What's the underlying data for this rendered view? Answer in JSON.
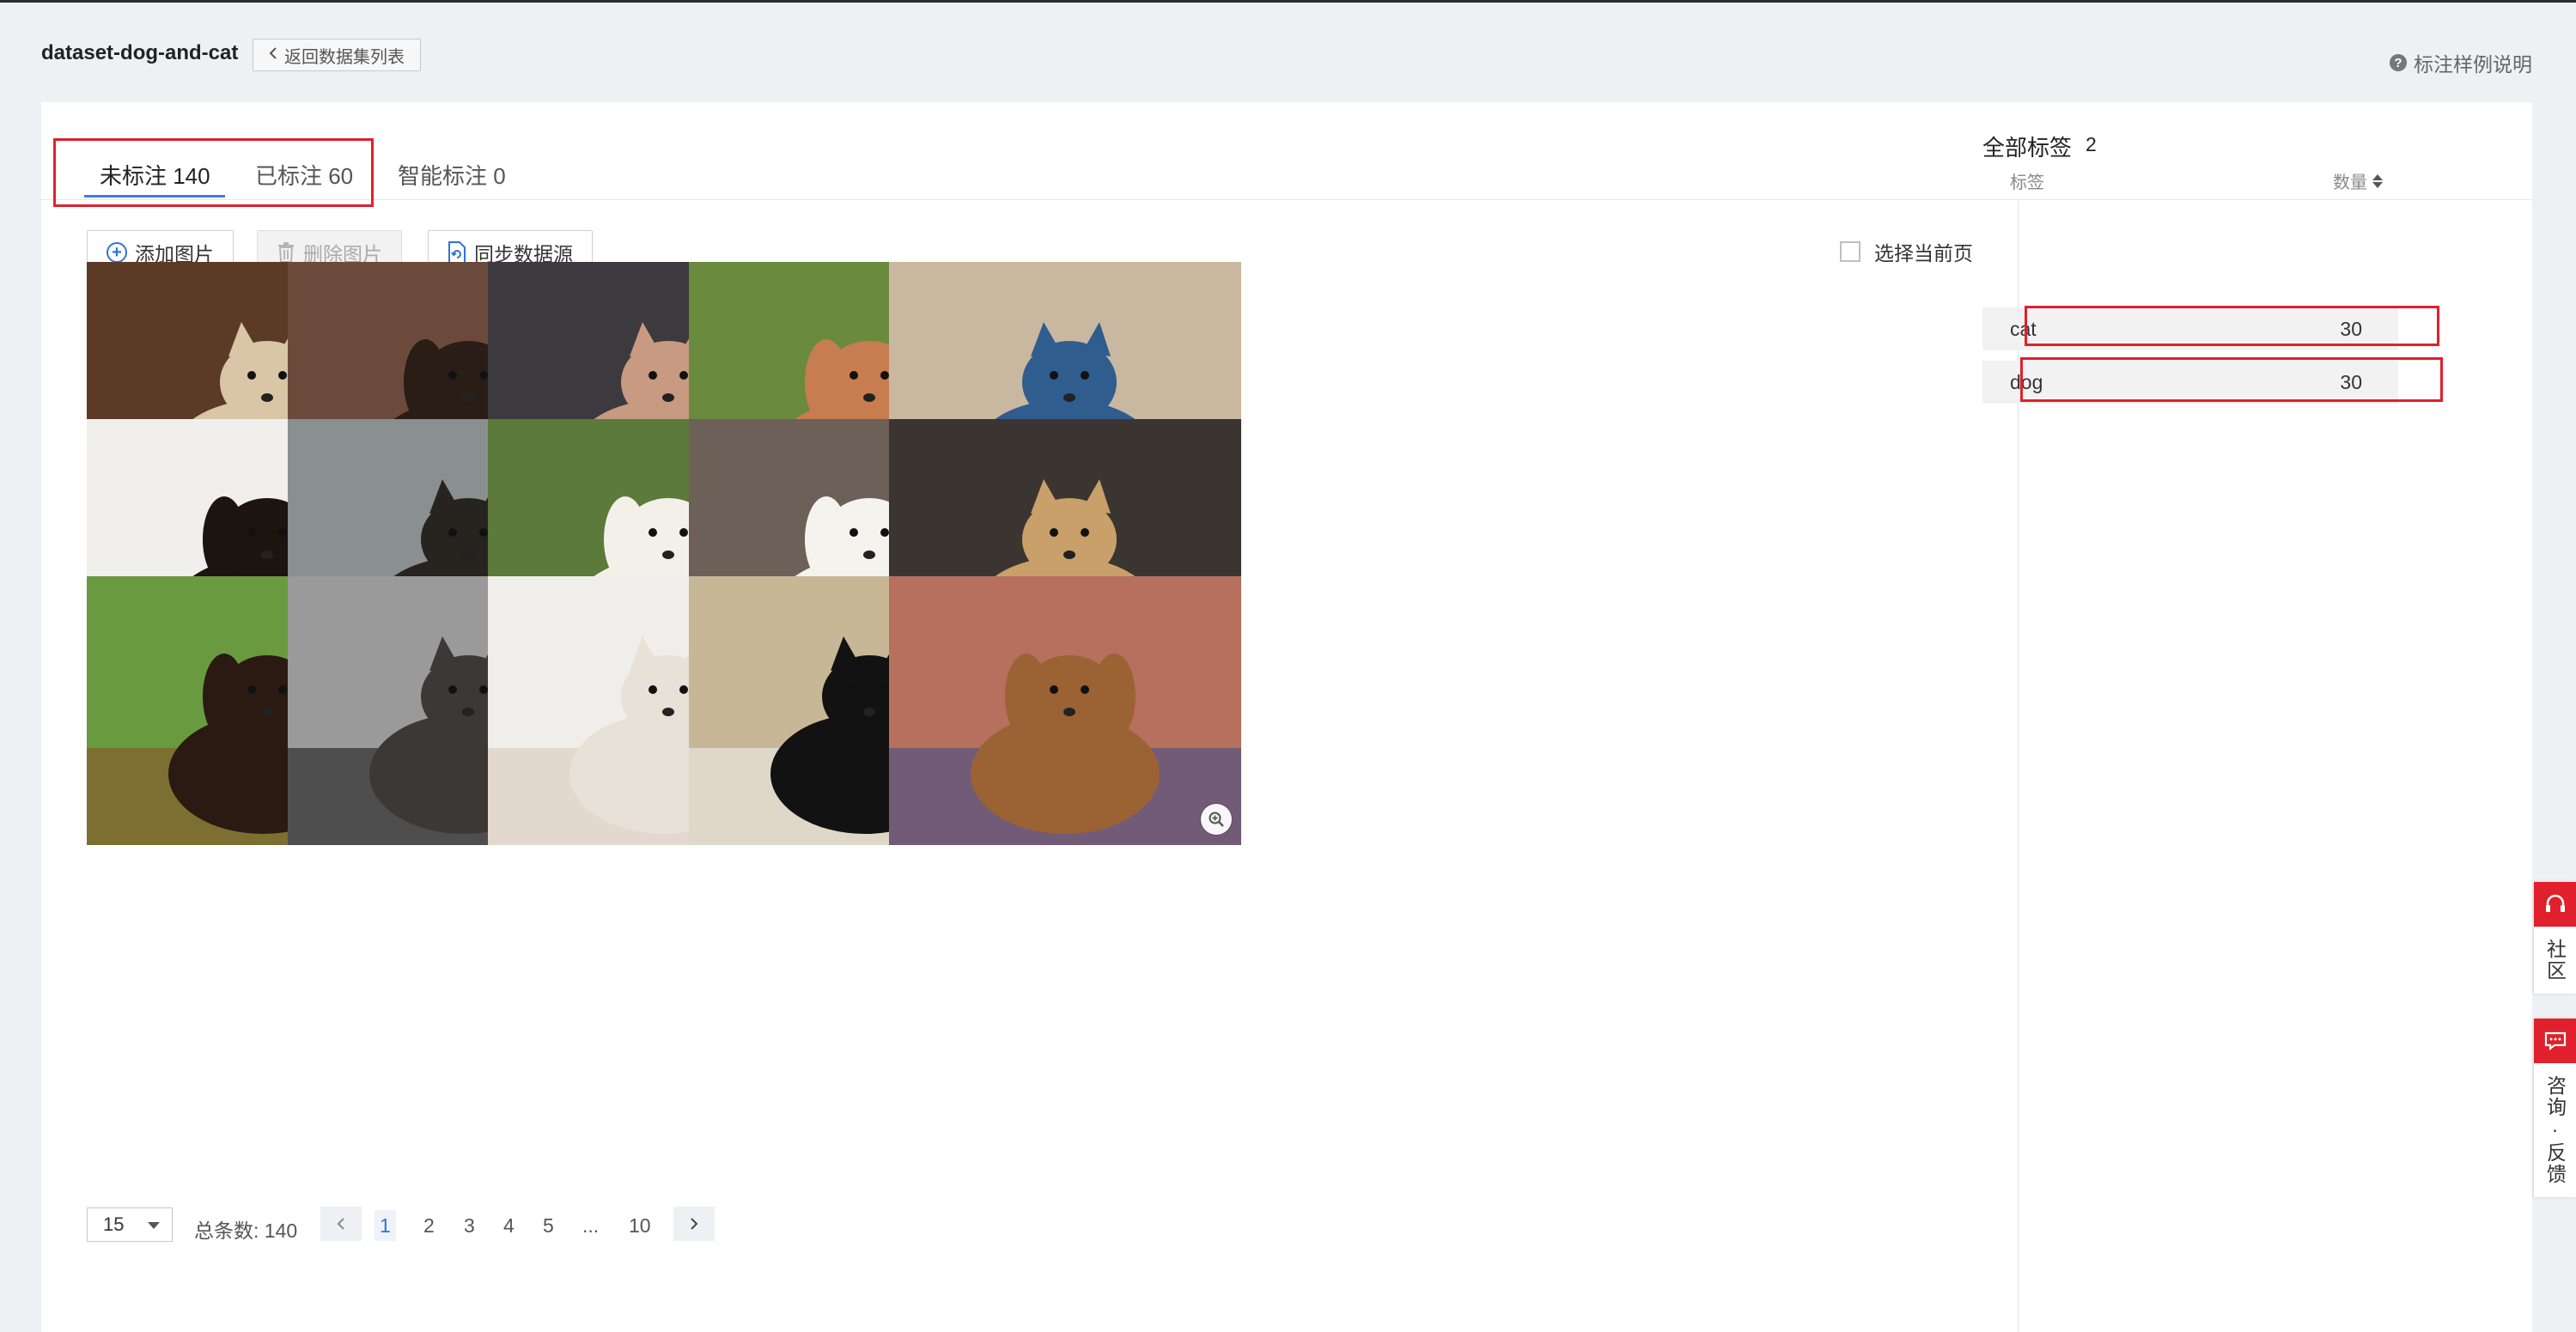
{
  "header": {
    "dataset_name": "dataset-dog-and-cat",
    "back_button": "返回数据集列表",
    "help_link": "标注样例说明"
  },
  "tabs": [
    {
      "label": "未标注 140",
      "active": true
    },
    {
      "label": "已标注 60",
      "active": false
    },
    {
      "label": "智能标注 0",
      "active": false
    }
  ],
  "toolbar": {
    "add_image": "添加图片",
    "delete_image": "删除图片",
    "sync_source": "同步数据源",
    "select_page": "选择当前页"
  },
  "images": [
    {
      "subject": "cat"
    },
    {
      "subject": "dog"
    },
    {
      "subject": "cat"
    },
    {
      "subject": "dog"
    },
    {
      "subject": "cat"
    },
    {
      "subject": "dog"
    },
    {
      "subject": "cat"
    },
    {
      "subject": "dog"
    },
    {
      "subject": "dog"
    },
    {
      "subject": "cat"
    },
    {
      "subject": "dog"
    },
    {
      "subject": "cat"
    },
    {
      "subject": "cat"
    },
    {
      "subject": "cat"
    },
    {
      "subject": "dog"
    }
  ],
  "pagination": {
    "page_size": "15",
    "total": "总条数: 140",
    "pages": [
      "1",
      "2",
      "3",
      "4",
      "5",
      "...",
      "10"
    ],
    "current": "1"
  },
  "labels_panel": {
    "title": "全部标签",
    "count": "2",
    "col_label": "标签",
    "col_qty": "数量",
    "rows": [
      {
        "name": "cat",
        "qty": "30"
      },
      {
        "name": "dog",
        "qty": "30"
      }
    ]
  },
  "float_widget": {
    "community": "社区",
    "feedback": "咨询·反馈"
  },
  "colors": {
    "accent": "#2f73d9",
    "highlight_box": "#e0202c",
    "widget_red": "#e0202c"
  }
}
